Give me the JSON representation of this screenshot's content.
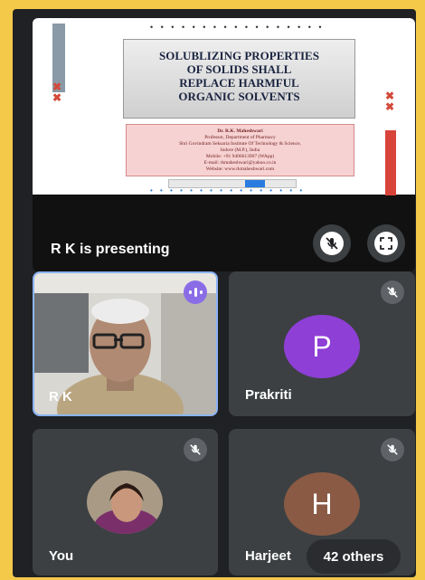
{
  "presentation": {
    "slide": {
      "title_lines": [
        "SOLUBLIZING PROPERTIES",
        "OF SOLIDS SHALL",
        "REPLACE HARMFUL",
        "ORGANIC SOLVENTS"
      ],
      "author_lines": [
        "Dr. R.K. Maheshwari",
        "Professor, Department of Pharmacy",
        "Shri Govindram Seksaria Institute Of Technology & Science,",
        "Indore (M.P.), India",
        "Mobile: +91 9406613907 (WApp)",
        "E-mail: rkmaheshwari@yahoo.co.in",
        "Website: www.rkmaheshwari.com"
      ]
    },
    "presenter_label": "R K is presenting"
  },
  "participants": [
    {
      "name": "R K",
      "kind": "video"
    },
    {
      "name": "Prakriti",
      "initial": "P",
      "avatar_color": "#8e3fd6",
      "muted": true
    },
    {
      "name": "You",
      "kind": "photo",
      "muted": true
    },
    {
      "name": "Harjeet",
      "initial": "H",
      "avatar_color": "#8a5a44",
      "muted": true
    }
  ],
  "others_label": "42 others",
  "icons": {
    "mute_presenter": "mic-off-icon",
    "fullscreen": "fullscreen-icon",
    "speaking": "audio-level-icon"
  },
  "colors": {
    "page_bg": "#f4c94a",
    "app_bg": "#202124",
    "tile_bg": "#3c4043"
  }
}
